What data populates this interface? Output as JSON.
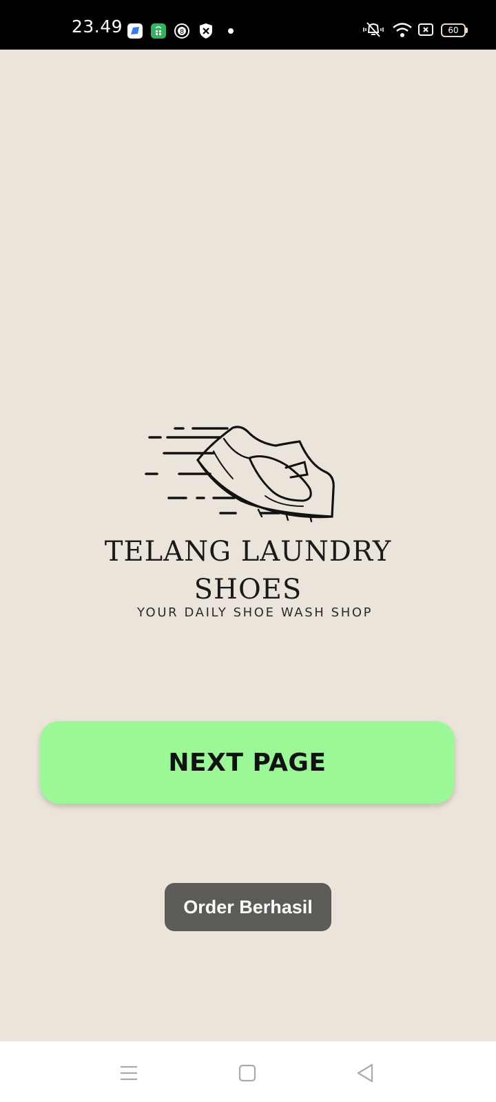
{
  "status_bar": {
    "time": "23.49",
    "battery_level": "60",
    "notification_icons": [
      "blue-app-icon",
      "green-store-icon",
      "circled-number-icon",
      "shield-x-icon",
      "dot-icon"
    ],
    "system_icons": [
      "vibrate-mute-icon",
      "wifi-icon",
      "sim-x-icon",
      "battery-icon"
    ]
  },
  "brand": {
    "line1": "TELANG LAUNDRY",
    "line2": "SHOES",
    "tagline": "YOUR DAILY SHOE WASH SHOP",
    "logo_icon": "running-shoe-icon"
  },
  "main": {
    "next_button_label": "NEXT PAGE"
  },
  "toast": {
    "message": "Order Berhasil"
  },
  "nav_bar": {
    "buttons": [
      "menu-icon",
      "home-square-icon",
      "back-triangle-icon"
    ]
  },
  "colors": {
    "background": "#ebe4da",
    "button": "#9af996",
    "toast": "#5c5b57",
    "status_bar": "#000000"
  }
}
